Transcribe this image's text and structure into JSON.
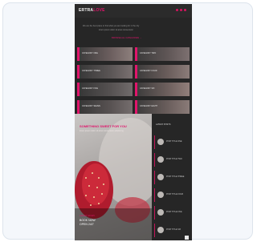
{
  "header": {
    "logo_main": "ERTRA",
    "logo_accent": "LOVE",
    "icons": [
      "search-icon",
      "user-icon",
      "menu-icon"
    ]
  },
  "intro": {
    "line1": "We are the best place to find what you are looking for in the city",
    "line2": "lorem ipsum dolor sit amet consectetur",
    "cta": "BROWSE ALL CATEGORIES →"
  },
  "grid": {
    "tiles": [
      {
        "label": "CATEGORY ONE"
      },
      {
        "label": "CATEGORY TWO"
      },
      {
        "label": "CATEGORY THREE"
      },
      {
        "label": "CATEGORY FOUR"
      },
      {
        "label": "CATEGORY FIVE"
      },
      {
        "label": "CATEGORY SIX"
      },
      {
        "label": "CATEGORY SEVEN"
      },
      {
        "label": "CATEGORY EIGHT"
      }
    ]
  },
  "hero": {
    "headline": "SOMETHING SWEET FOR YOU",
    "subline": "lorem ipsum dolor sit amet consectetur adipiscing",
    "tag": "LATEST STORY",
    "title1": "BOOK NOW",
    "title2": "OPEN 24/7"
  },
  "sidebar": {
    "heading": "LATEST POSTS",
    "items": [
      {
        "label": "POST TITLE ONE"
      },
      {
        "label": "POST TITLE TWO"
      },
      {
        "label": "POST TITLE THREE"
      },
      {
        "label": "POST TITLE FOUR"
      },
      {
        "label": "POST TITLE FIVE"
      },
      {
        "label": "POST TITLE SIX"
      }
    ]
  },
  "colors": {
    "accent": "#e0156b",
    "background": "#262626",
    "card": "#f4f7fb"
  }
}
